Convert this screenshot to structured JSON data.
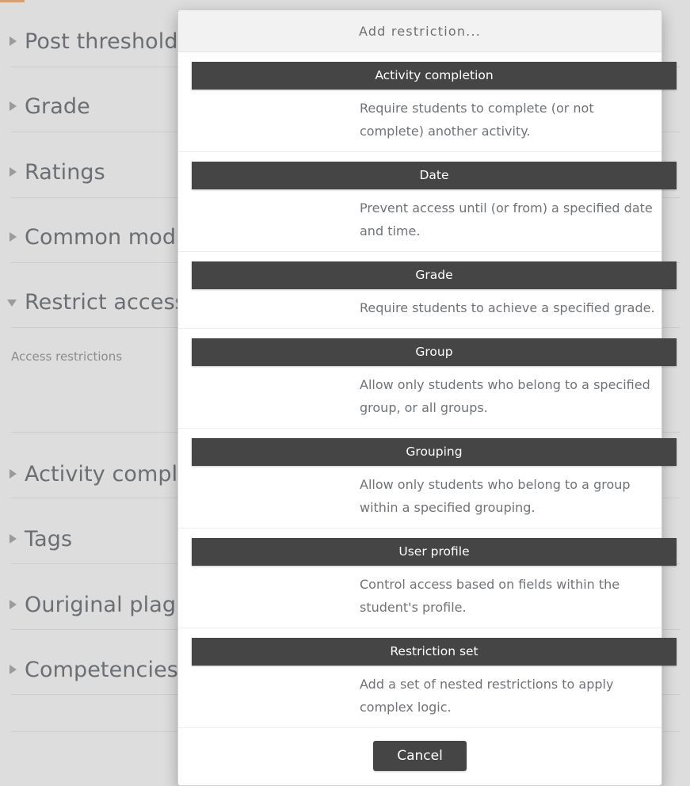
{
  "page": {
    "sections": [
      {
        "label": "Post threshold",
        "expanded": false
      },
      {
        "label": "Grade",
        "expanded": false
      },
      {
        "label": "Ratings",
        "expanded": false
      },
      {
        "label": "Common mod",
        "expanded": false
      },
      {
        "label": "Restrict access",
        "expanded": true
      },
      {
        "label": "Activity comple",
        "expanded": false
      },
      {
        "label": "Tags",
        "expanded": false
      },
      {
        "label": "Ouriginal plagi",
        "expanded": false
      },
      {
        "label": "Competencies",
        "expanded": false
      }
    ],
    "access_restrictions_label": "Access restrictions"
  },
  "modal": {
    "title": "Add restriction...",
    "options": [
      {
        "label": "Activity completion",
        "description": "Require students to complete (or not complete) another activity."
      },
      {
        "label": "Date",
        "description": "Prevent access until (or from) a specified date and time."
      },
      {
        "label": "Grade",
        "description": "Require students to achieve a specified grade."
      },
      {
        "label": "Group",
        "description": "Allow only students who belong to a specified group, or all groups."
      },
      {
        "label": "Grouping",
        "description": "Allow only students who belong to a group within a specified grouping."
      },
      {
        "label": "User profile",
        "description": "Control access based on fields within the student's profile."
      },
      {
        "label": "Restriction set",
        "description": "Add a set of nested restrictions to apply complex logic."
      }
    ],
    "cancel_label": "Cancel"
  },
  "colors": {
    "dark_button": "#454545",
    "page_background": "#dddddd",
    "accent": "#d79f74",
    "heading_text": "#6b6f73"
  }
}
